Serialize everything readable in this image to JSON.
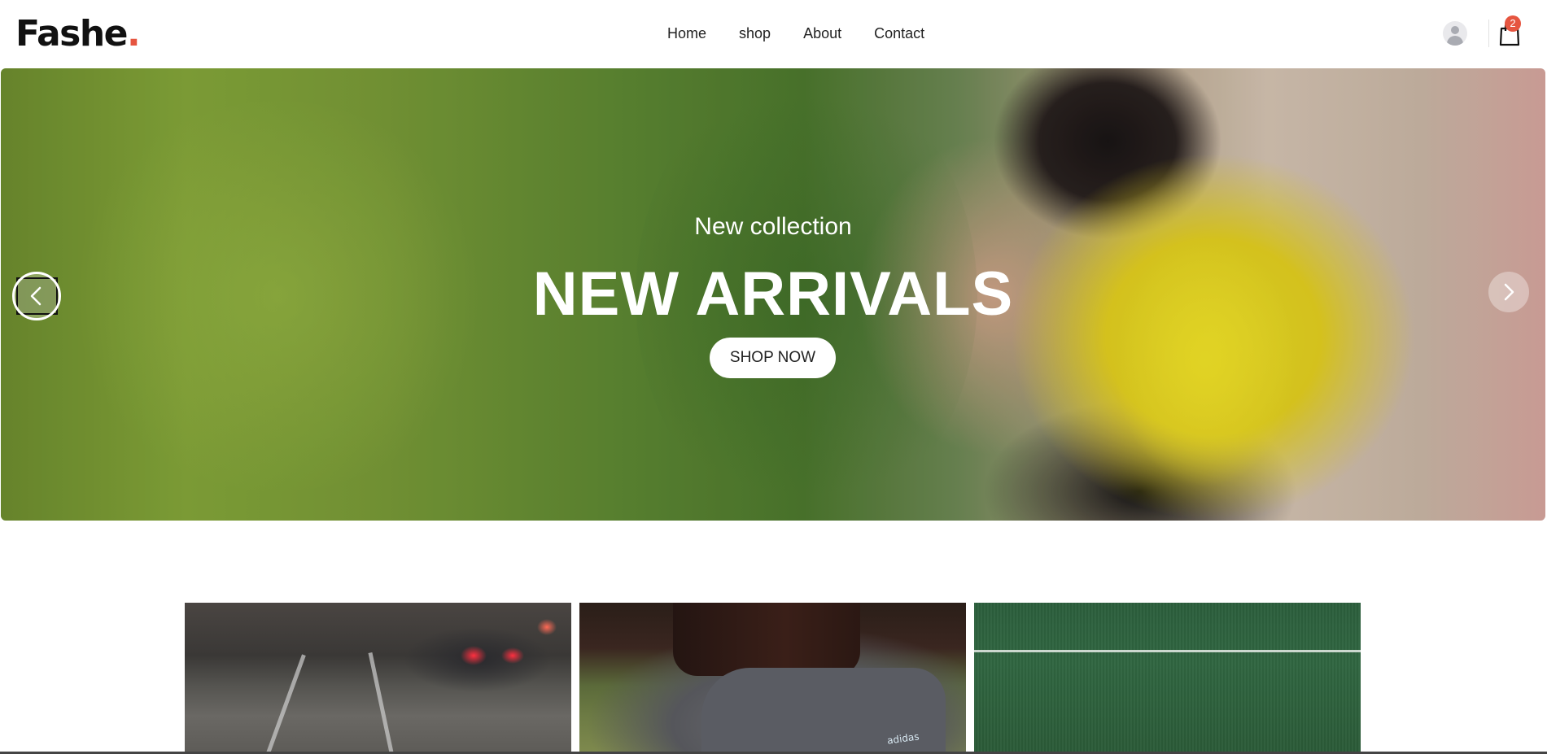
{
  "header": {
    "logo_text": "Fashe",
    "logo_dot": ".",
    "nav": [
      "Home",
      "shop",
      "About",
      "Contact"
    ],
    "cart_count": "2",
    "icons": {
      "user": "user-avatar-icon",
      "cart": "shopping-bag-icon"
    }
  },
  "hero": {
    "subtitle": "New collection",
    "title": "NEW ARRIVALS",
    "cta_label": "SHOP NOW",
    "prev_icon": "chevron-left-icon",
    "next_icon": "chevron-right-icon"
  },
  "categories": {
    "brand_text": "adidas"
  },
  "colors": {
    "accent": "#e65540",
    "text": "#222222",
    "background": "#ffffff"
  }
}
